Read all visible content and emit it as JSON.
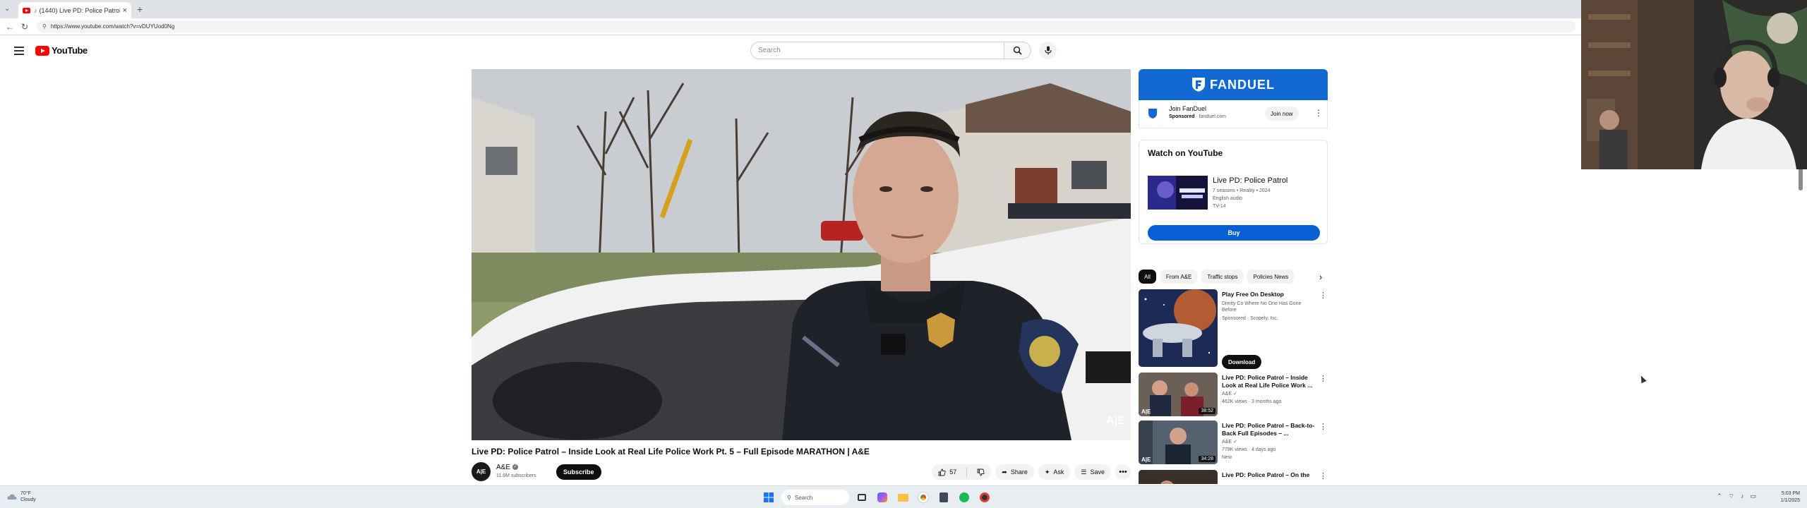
{
  "browser": {
    "tab_title": "(1440) Live PD: Police Patrol –",
    "new_tab": "+",
    "url": "https://www.youtube.com/watch?v=vDUYUod0Ng"
  },
  "masthead": {
    "logo_text": "YouTube",
    "search_placeholder": "Search"
  },
  "video": {
    "title": "Live PD: Police Patrol – Inside Look at Real Life Police Work Pt. 5 – Full Episode MARATHON | A&E",
    "watermark": "A|E",
    "channel_avatar_text": "A|E",
    "channel_name": "A&E",
    "subscribers": "11.6M subscribers",
    "subscribe_label": "Subscribe",
    "likes": "57",
    "share_label": "Share",
    "ask_label": "Ask",
    "save_label": "Save",
    "more_label": "•••"
  },
  "sidebar": {
    "ad": {
      "brand": "FANDUEL",
      "title": "Join FanDuel",
      "sponsored": "Sponsored",
      "domain": "· fanduel.com",
      "join_label": "Join now",
      "kebab": "⋮"
    },
    "watch_on_youtube": {
      "heading": "Watch on YouTube",
      "show_title": "Live PD: Police Patrol",
      "meta1": "7 seasons • Reality • 2024",
      "meta2": "English audio",
      "rating": "TV-14",
      "buy_label": "Buy"
    },
    "chips": [
      "All",
      "From A&E",
      "Traffic stops",
      "Policies News"
    ],
    "chips_arrow": "›",
    "recommendations": [
      {
        "title": "Play Free On Desktop",
        "line1": "Dimity Co Where No One Has Gone Before",
        "line2": "Sponsored · Scopely, Inc.",
        "button": "Download",
        "duration": ""
      },
      {
        "title": "Live PD: Police Patrol – Inside Look at Real Life Police Work ...",
        "line1": "A&E ✓",
        "line2": "462K views · 3 months ago",
        "duration": "38:52"
      },
      {
        "title": "Live PD: Police Patrol – Back-to-Back Full Episodes – ...",
        "line1": "A&E ✓",
        "line2": "779K views · 4 days ago",
        "line3": "New",
        "duration": "34:28"
      },
      {
        "title": "Live PD: Police Patrol – On the",
        "duration": ""
      }
    ]
  },
  "taskbar": {
    "weather_temp": "70°F",
    "weather_cond": "Cloudy",
    "search_label": "Search",
    "time": "5:03 PM",
    "date": "1/1/2025"
  },
  "colors": {
    "youtube_red": "#ff0000",
    "fanduel_blue": "#1269d3",
    "buy_blue": "#065fd4"
  }
}
